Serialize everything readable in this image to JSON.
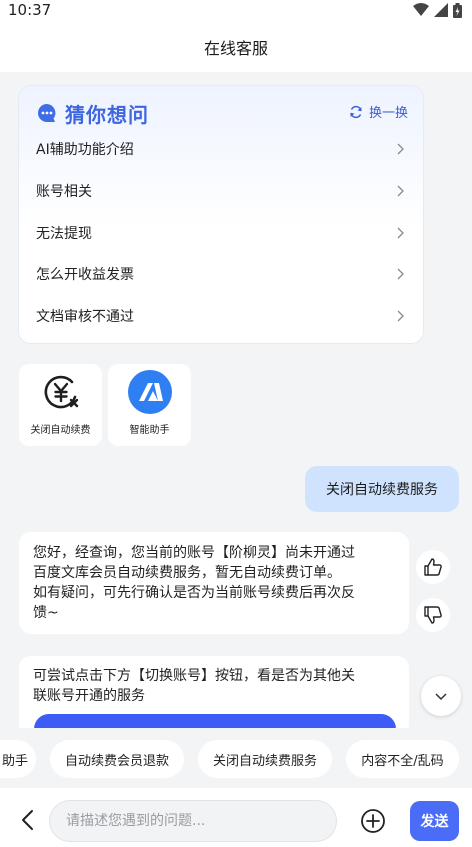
{
  "status_bar": {
    "time": "10:37",
    "icons": [
      "wifi-icon",
      "signal-icon",
      "battery-icon"
    ]
  },
  "header": {
    "title": "在线客服"
  },
  "faq": {
    "title": "猜你想问",
    "refresh_label": "换一换",
    "items": [
      {
        "label": "AI辅助功能介绍"
      },
      {
        "label": "账号相关"
      },
      {
        "label": "无法提现"
      },
      {
        "label": "怎么开收益发票"
      },
      {
        "label": "文档审核不通过"
      }
    ]
  },
  "quick_actions": [
    {
      "label": "关闭自动续费",
      "icon": "cancel-autorenew-icon"
    },
    {
      "label": "智能助手",
      "icon": "ai-assistant-icon"
    }
  ],
  "messages": [
    {
      "from": "user",
      "text": "关闭自动续费服务"
    },
    {
      "from": "agent",
      "lines": [
        "您好，经查询，您当前的账号【阶柳灵】尚未开通过",
        "百度文库会员自动续费服务，暂无自动续费订单。",
        "如有疑问，可先行确认是否为当前账号续费后再次反",
        "馈~"
      ]
    },
    {
      "from": "agent",
      "lines": [
        "可尝试点击下方【切换账号】按钮，看是否为其他关",
        "联账号开通的服务"
      ]
    }
  ],
  "chips": [
    "助手",
    "自动续费会员退款",
    "关闭自动续费服务",
    "内容不全/乱码"
  ],
  "input": {
    "placeholder": "请描述您遇到的问题...",
    "value": ""
  },
  "send_label": "发送",
  "colors": {
    "accent": "#4a6cf7",
    "user_bubble": "#cfe3ff",
    "faq_title": "#3d66e0"
  }
}
